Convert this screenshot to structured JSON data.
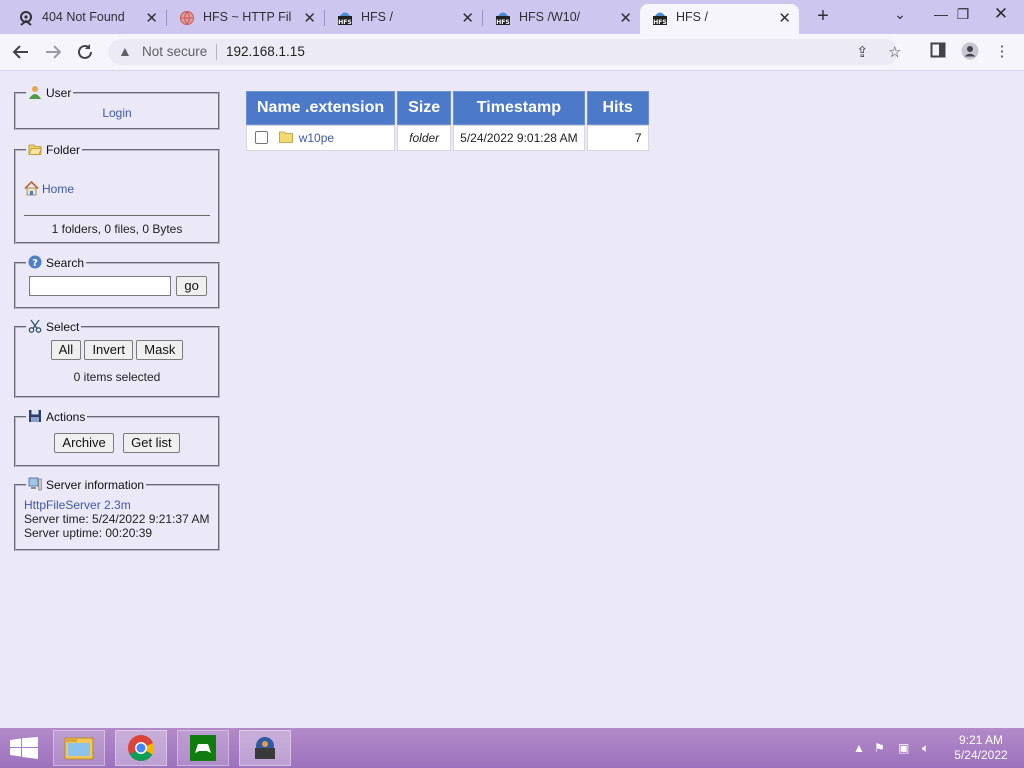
{
  "browser": {
    "tabs": [
      {
        "title": "404 Not Found",
        "active": false
      },
      {
        "title": "HFS ~ HTTP File Server",
        "active": false
      },
      {
        "title": "HFS /",
        "active": false
      },
      {
        "title": "HFS /W10/",
        "active": false
      },
      {
        "title": "HFS /",
        "active": true
      }
    ],
    "security_label": "Not secure",
    "url": "192.168.1.15"
  },
  "panels": {
    "user": {
      "title": "User",
      "login_label": "Login"
    },
    "folder": {
      "title": "Folder",
      "home_label": "Home",
      "summary": "1 folders, 0 files, 0 Bytes"
    },
    "search": {
      "title": "Search",
      "input_value": "",
      "go_label": "go"
    },
    "select": {
      "title": "Select",
      "all_label": "All",
      "invert_label": "Invert",
      "mask_label": "Mask",
      "status": "0 items selected"
    },
    "actions": {
      "title": "Actions",
      "archive_label": "Archive",
      "getlist_label": "Get list"
    },
    "server": {
      "title": "Server information",
      "software": "HttpFileServer 2.3m",
      "time": "Server time: 5/24/2022 9:21:37 AM",
      "uptime": "Server uptime: 00:20:39"
    }
  },
  "file_table": {
    "headers": {
      "name": "Name .extension",
      "size": "Size",
      "timestamp": "Timestamp",
      "hits": "Hits"
    },
    "rows": [
      {
        "name": "w10pe",
        "size": "folder",
        "timestamp": "5/24/2022 9:01:28 AM",
        "hits": "7"
      }
    ]
  },
  "taskbar": {
    "time": "9:21 AM",
    "date": "5/24/2022"
  },
  "colors": {
    "table_header": "#4c7ac8",
    "page_background": "#ebe8f8",
    "tab_strip": "#cdc6ef",
    "link": "#3d5aa8"
  }
}
